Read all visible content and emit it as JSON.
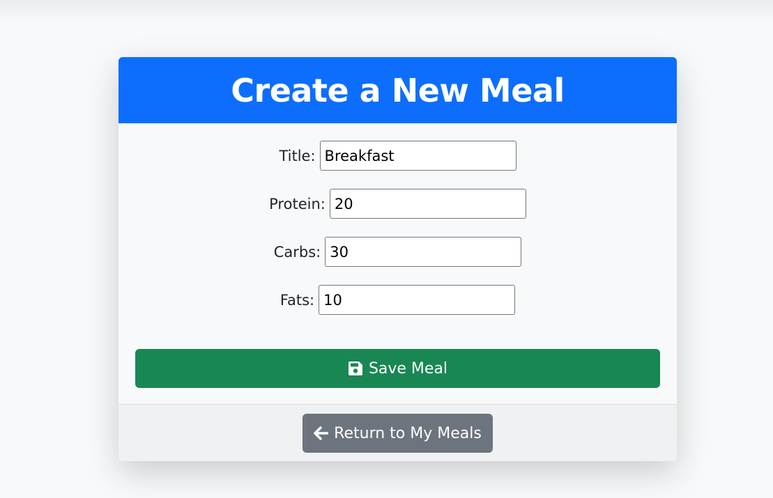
{
  "header": {
    "title": "Create a New Meal"
  },
  "form": {
    "fields": [
      {
        "label": "Title:",
        "value": "Breakfast"
      },
      {
        "label": "Protein:",
        "value": "20"
      },
      {
        "label": "Carbs:",
        "value": "30"
      },
      {
        "label": "Fats:",
        "value": "10"
      }
    ],
    "save_label": "Save Meal",
    "save_icon": "floppy-disk-icon"
  },
  "footer": {
    "return_label": "Return to My Meals",
    "return_icon": "arrow-left-icon"
  },
  "colors": {
    "header_bg": "#0d6efd",
    "save_bg": "#198754",
    "return_bg": "#6c757d"
  }
}
